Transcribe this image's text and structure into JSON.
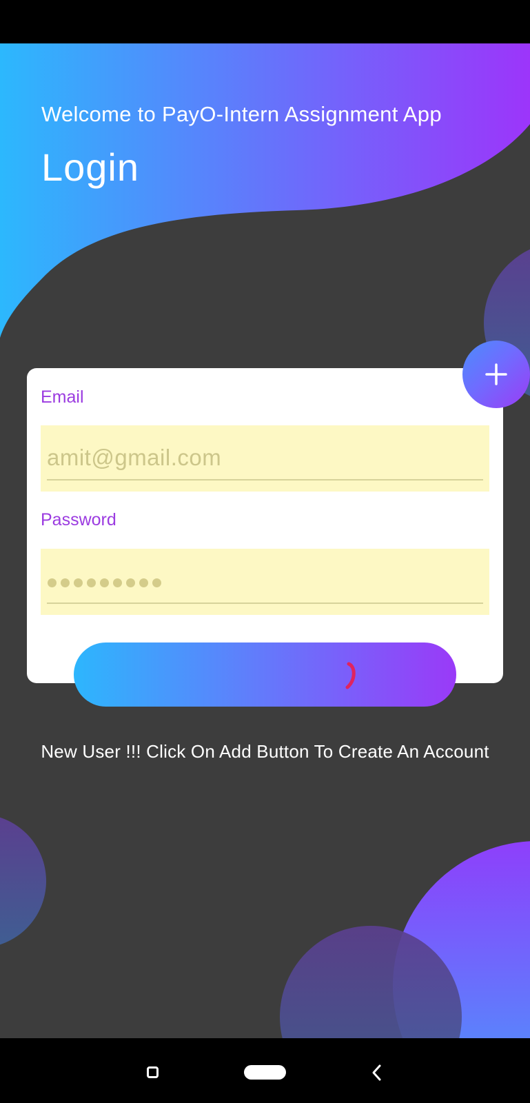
{
  "header": {
    "welcome": "Welcome to PayO-Intern Assignment App",
    "title": "Login"
  },
  "form": {
    "email_label": "Email",
    "email_placeholder": "amit@gmail.com",
    "password_label": "Password",
    "password_mask_length": 9
  },
  "footer": {
    "hint": "New User !!! Click On Add Button To Create An Account"
  },
  "icons": {
    "add": "plus-icon",
    "loading": "spinner-icon",
    "nav_recents": "square-icon",
    "nav_home": "pill-icon",
    "nav_back": "chevron-left-icon"
  },
  "colors": {
    "background": "#3d3d3d",
    "gradient_start": "#2db6fd",
    "gradient_end": "#9a3af8",
    "label": "#9b3be0",
    "field_bg": "#fdf8c4",
    "spinner": "#e0245e"
  }
}
